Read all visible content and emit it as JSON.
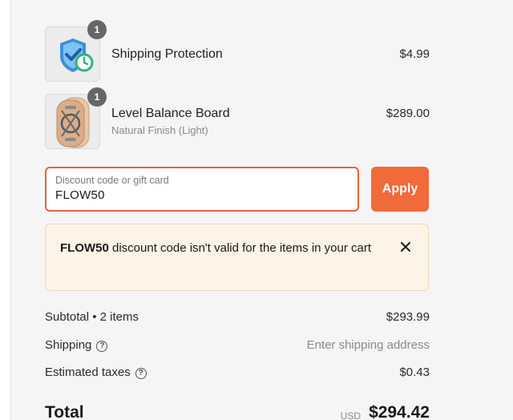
{
  "line_items": [
    {
      "name": "Shipping Protection",
      "variant": "",
      "price": "$4.99",
      "quantity": "1",
      "icon": "shield-clock-icon"
    },
    {
      "name": "Level Balance Board",
      "variant": "Natural Finish (Light)",
      "price": "$289.00",
      "quantity": "1",
      "icon": "balance-board-image"
    }
  ],
  "discount": {
    "label": "Discount code or gift card",
    "value": "FLOW50",
    "apply_label": "Apply",
    "accent_color": "#f06a3a"
  },
  "error": {
    "code": "FLOW50",
    "message": " discount code isn't valid for the items in your cart",
    "close_icon": "close-icon"
  },
  "summary": {
    "subtotal_label": "Subtotal • 2 items",
    "subtotal_value": "$293.99",
    "shipping_label": "Shipping",
    "shipping_value": "Enter shipping address",
    "taxes_label": "Estimated taxes",
    "taxes_value": "$0.43",
    "help_icon": "help-circle-icon"
  },
  "total": {
    "label": "Total",
    "currency": "USD",
    "value": "$294.42"
  }
}
